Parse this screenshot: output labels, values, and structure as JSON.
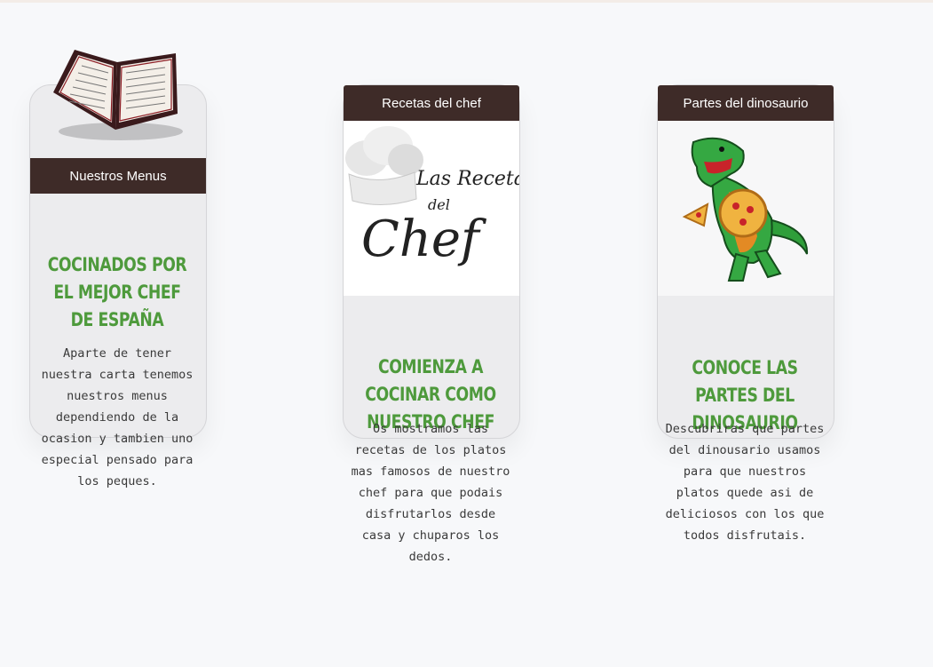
{
  "cards": [
    {
      "header": "Nuestros Menus",
      "title": "Cocinados por el mejor chef de España",
      "description": "Aparte de tener nuestra carta tenemos nuestros menus dependiendo de la ocasion y tambien uno especial pensado para los peques.",
      "icon": "menu-book-icon"
    },
    {
      "header": "Recetas del chef",
      "title": "Comienza a cocinar como nuestro chef",
      "description": "Os mostramos las recetas de los platos mas famosos de nuestro chef para que podais disfrutarlos desde casa y chuparos los dedos.",
      "image_text": [
        "Las Recetas",
        "del",
        "Chef"
      ],
      "icon": "chef-hat-icon"
    },
    {
      "header": "Partes del dinosaurio",
      "title": "Conoce las partes del dinosaurio",
      "description": "Descubriras que partes del dinousario usamos para que nuestros platos quede asi de deliciosos con los que todos disfrutais.",
      "icon": "dinosaur-pizza-icon"
    }
  ],
  "colors": {
    "header_bg": "#3e2b28",
    "title_green": "#4e9a3c",
    "card_bg": "#ececee"
  }
}
